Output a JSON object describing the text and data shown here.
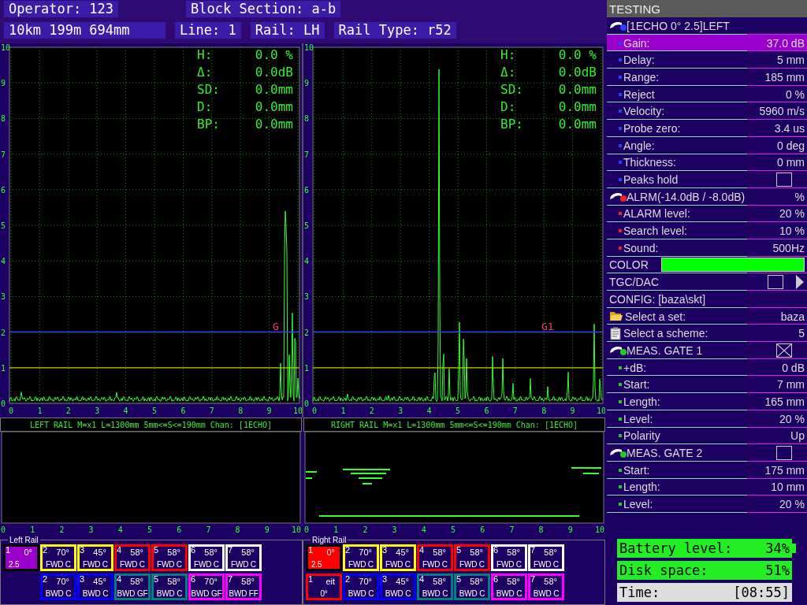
{
  "header": {
    "operator": "Operator: 123",
    "block_section": "Block Section: a-b",
    "position": "10km 199m 694mm",
    "line": "Line: 1",
    "rail": "Rail: LH",
    "rail_type": "Rail Type: r52"
  },
  "a_scans": [
    {
      "y_ticks": [
        "10",
        "9",
        "8",
        "7",
        "6",
        "5",
        "4",
        "3",
        "2",
        "1",
        "0"
      ],
      "x_ticks": [
        "0",
        "1",
        "2",
        "3",
        "4",
        "5",
        "6",
        "7",
        "8",
        "9",
        "10"
      ],
      "readings": [
        {
          "label": "H:",
          "value": "0.0 %"
        },
        {
          "label": "Δ:",
          "value": "0.0dB"
        },
        {
          "label": "SD:",
          "value": "0.0mm"
        },
        {
          "label": "D:",
          "value": "0.0mm"
        },
        {
          "label": "BP:",
          "value": "0.0mm"
        }
      ],
      "gate_label": "G"
    },
    {
      "y_ticks": [
        "10",
        "9",
        "8",
        "7",
        "6",
        "5",
        "4",
        "3",
        "2",
        "1",
        "0"
      ],
      "x_ticks": [
        "0",
        "1",
        "2",
        "3",
        "4",
        "5",
        "6",
        "7",
        "8",
        "9",
        "10"
      ],
      "readings": [
        {
          "label": "H:",
          "value": "0.0 %"
        },
        {
          "label": "Δ:",
          "value": "0.0dB"
        },
        {
          "label": "SD:",
          "value": "0.0mm"
        },
        {
          "label": "D:",
          "value": "0.0mm"
        },
        {
          "label": "BP:",
          "value": "0.0mm"
        }
      ],
      "gate_label": "G1"
    }
  ],
  "b_scans": [
    {
      "caption": "LEFT RAIL M=x1  L=1300mm 5mm<=S<=190mm Chan: [1ECHO]",
      "x_ticks": [
        "0",
        "1",
        "2",
        "3",
        "4",
        "5",
        "6",
        "7",
        "8",
        "9",
        "10"
      ]
    },
    {
      "caption": "RIGHT RAIL M=x1  L=1300mm 5mm<=S<=190mm Chan: [1ECHO]",
      "x_ticks": [
        "0",
        "1",
        "2",
        "3",
        "4",
        "5",
        "6",
        "7",
        "8",
        "9",
        "10"
      ]
    }
  ],
  "settings": {
    "title": "TESTING",
    "rows": [
      {
        "kind": "group",
        "label": "[1ECHO 0° 2.5]LEFT",
        "color": "#2244ff",
        "selected": false
      },
      {
        "kind": "param",
        "label": "Gain:",
        "value": "37.0 dB",
        "color": "#2244ff",
        "selected": true
      },
      {
        "kind": "param",
        "label": "Delay:",
        "value": "5 mm",
        "color": "#2244ff",
        "selected": false
      },
      {
        "kind": "param",
        "label": "Range:",
        "value": "185 mm",
        "color": "#2244ff",
        "selected": false
      },
      {
        "kind": "param",
        "label": "Reject",
        "value": "0 %",
        "color": "#2244ff",
        "selected": false
      },
      {
        "kind": "param",
        "label": "Velocity:",
        "value": "5960 m/s",
        "color": "#2244ff",
        "selected": false
      },
      {
        "kind": "param",
        "label": "Probe zero:",
        "value": "3.4 us",
        "color": "#2244ff",
        "selected": false
      },
      {
        "kind": "param",
        "label": "Angle:",
        "value": "0 deg",
        "color": "#2244ff",
        "selected": false
      },
      {
        "kind": "param",
        "label": "Thickness:",
        "value": "0 mm",
        "color": "#2244ff",
        "selected": false
      },
      {
        "kind": "param",
        "label": "Peaks hold",
        "checked": false,
        "color": "#2244ff",
        "selected": false
      },
      {
        "kind": "group",
        "label": "ALRM(-14.0dB / -8.0dB)",
        "value": "%",
        "color": "#ee2222",
        "selected": false
      },
      {
        "kind": "param",
        "label": "ALARM level:",
        "value": "20 %",
        "color": "#ee2222",
        "selected": false
      },
      {
        "kind": "param",
        "label": "Search level:",
        "value": "10 %",
        "color": "#ee2222",
        "selected": false
      },
      {
        "kind": "param",
        "label": "Sound:",
        "value": "500Hz",
        "color": "#ee2222",
        "selected": false
      },
      {
        "kind": "swatch",
        "label": "COLOR",
        "color": "#00ff00",
        "selected": false
      },
      {
        "kind": "toggle",
        "label": "TGC/DAC",
        "checked": false,
        "selected": false
      },
      {
        "kind": "text",
        "label": "CONFIG: [baza\\skt]",
        "selected": false
      },
      {
        "kind": "folder",
        "label": "Select a set:",
        "value": "baza",
        "selected": false
      },
      {
        "kind": "clipboard",
        "label": "Select a scheme:",
        "value": "5",
        "selected": false
      },
      {
        "kind": "group",
        "label": "MEAS. GATE 1",
        "checked": true,
        "color": "#22cc22",
        "selected": false
      },
      {
        "kind": "param",
        "label": "+dB:",
        "value": "0 dB",
        "color": "#22cc22",
        "selected": false
      },
      {
        "kind": "param",
        "label": "Start:",
        "value": "7 mm",
        "color": "#22cc22",
        "selected": false
      },
      {
        "kind": "param",
        "label": "Length:",
        "value": "165 mm",
        "color": "#22cc22",
        "selected": false
      },
      {
        "kind": "param",
        "label": "Level:",
        "value": "20 %",
        "color": "#22cc22",
        "selected": false
      },
      {
        "kind": "param",
        "label": "Polarity",
        "value": "Up",
        "color": "#22cc22",
        "selected": false
      },
      {
        "kind": "group",
        "label": "MEAS. GATE 2",
        "checked": false,
        "color": "#22cc22",
        "selected": false
      },
      {
        "kind": "param",
        "label": "Start:",
        "value": "175 mm",
        "color": "#22cc22",
        "selected": false
      },
      {
        "kind": "param",
        "label": "Length:",
        "value": "10 mm",
        "color": "#22cc22",
        "selected": false
      },
      {
        "kind": "param",
        "label": "Level:",
        "value": "20 %",
        "color": "#22cc22",
        "selected": false
      }
    ]
  },
  "rails": [
    {
      "title": "Left Rail",
      "rows": [
        [
          {
            "number": "1",
            "angle": "0°",
            "label": "2.5",
            "color": "#9900cc",
            "selected": true
          },
          {
            "number": "2",
            "angle": "70°",
            "label": "FWD C",
            "color": "#ffff00",
            "selected": false
          },
          {
            "number": "3",
            "angle": "45°",
            "label": "FWD C",
            "color": "#ffff00",
            "selected": false
          },
          {
            "number": "4",
            "angle": "58°",
            "label": "FWD C",
            "color": "#ff0000",
            "selected": false
          },
          {
            "number": "5",
            "angle": "58°",
            "label": "FWD C",
            "color": "#ff0000",
            "selected": false
          },
          {
            "number": "6",
            "angle": "58°",
            "label": "FWD C",
            "color": "#ffffff",
            "selected": false
          },
          {
            "number": "7",
            "angle": "58°",
            "label": "FWD C",
            "color": "#ffffff",
            "selected": false
          }
        ],
        [
          "",
          {
            "number": "2",
            "angle": "70°",
            "label": "BWD C",
            "color": "#0000ff",
            "selected": false
          },
          {
            "number": "3",
            "angle": "45°",
            "label": "BWD C",
            "color": "#0000ff",
            "selected": false
          },
          {
            "number": "4",
            "angle": "58°",
            "label": "BWD GF",
            "color": "#008080",
            "selected": false
          },
          {
            "number": "5",
            "angle": "58°",
            "label": "BWD C",
            "color": "#008080",
            "selected": false
          },
          {
            "number": "6",
            "angle": "70°",
            "label": "BWD GF",
            "color": "#ff00ff",
            "selected": false
          },
          {
            "number": "7",
            "angle": "58°",
            "label": "BWD FF",
            "color": "#ff00ff",
            "selected": false
          }
        ]
      ]
    },
    {
      "title": "Right Rail",
      "rows": [
        [
          {
            "number": "1",
            "angle": "0°",
            "label": "2.5",
            "color": "#ff0000",
            "selected": true
          },
          {
            "number": "2",
            "angle": "70°",
            "label": "FWD C",
            "color": "#ffff00",
            "selected": false
          },
          {
            "number": "3",
            "angle": "45°",
            "label": "FWD C",
            "color": "#ffff00",
            "selected": false
          },
          {
            "number": "4",
            "angle": "58°",
            "label": "FWD C",
            "color": "#ff0000",
            "selected": false
          },
          {
            "number": "5",
            "angle": "58°",
            "label": "FWD C",
            "color": "#ff0000",
            "selected": false
          },
          {
            "number": "6",
            "angle": "58°",
            "label": "FWD C",
            "color": "#ffffff",
            "selected": false
          },
          {
            "number": "7",
            "angle": "58°",
            "label": "FWD C",
            "color": "#ffffff",
            "selected": false
          }
        ],
        [
          {
            "number": "1",
            "angle": "eit",
            "label": "0°",
            "color": "#ff0000",
            "selected": false
          },
          {
            "number": "2",
            "angle": "70°",
            "label": "BWD C",
            "color": "#0000ff",
            "selected": false
          },
          {
            "number": "3",
            "angle": "45°",
            "label": "BWD C",
            "color": "#0000ff",
            "selected": false
          },
          {
            "number": "4",
            "angle": "58°",
            "label": "BWD C",
            "color": "#008080",
            "selected": false
          },
          {
            "number": "5",
            "angle": "58°",
            "label": "BWD C",
            "color": "#008080",
            "selected": false
          },
          {
            "number": "6",
            "angle": "58°",
            "label": "BWD C",
            "color": "#ff00ff",
            "selected": false
          },
          {
            "number": "7",
            "angle": "58°",
            "label": "BWD C",
            "color": "#ff00ff",
            "selected": false
          }
        ]
      ]
    }
  ],
  "status": [
    {
      "kind": "battery",
      "label": "Battery level:",
      "value": "34%"
    },
    {
      "kind": "disk",
      "label": "Disk space:",
      "value": "51%"
    },
    {
      "kind": "time",
      "label": "Time:",
      "value": "[08:55]"
    }
  ]
}
